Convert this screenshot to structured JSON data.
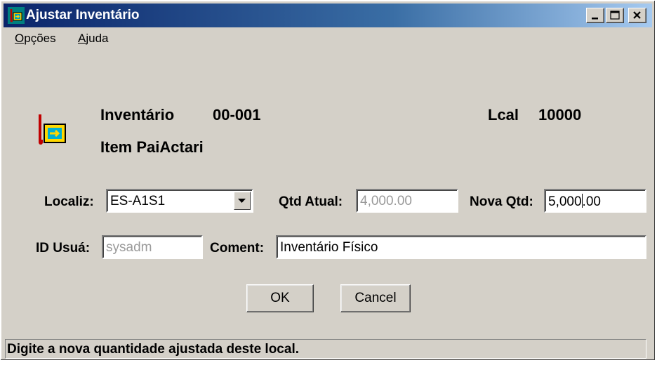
{
  "window": {
    "title": "Ajustar Inventário"
  },
  "menu": {
    "items": [
      {
        "label": "Opções",
        "accel": "O"
      },
      {
        "label": "Ajuda",
        "accel": "A"
      }
    ]
  },
  "header": {
    "inventory_label": "Inventário",
    "inventory_value": "00-001",
    "item_text": "Item PaiActari",
    "local_label": "Lcal",
    "local_value": "10000"
  },
  "form": {
    "location_label": "Localiz:",
    "location_value": "ES-A1S1",
    "current_qty_label": "Qtd Atual:",
    "current_qty_value": "4,000.00",
    "new_qty_label": "Nova Qtd:",
    "new_qty_before_caret": "5,000",
    "new_qty_after_caret": ".00",
    "user_id_label": "ID Usuá:",
    "user_id_value": "sysadm",
    "comment_label": "Coment:",
    "comment_value": "Inventário Físico"
  },
  "buttons": {
    "ok": "OK",
    "cancel": "Cancel"
  },
  "status": {
    "message": "Digite a nova quantidade ajustada deste local."
  },
  "colors": {
    "titlebar_start": "#0a246a",
    "titlebar_end": "#a6caf0",
    "face": "#d4d0c8"
  }
}
